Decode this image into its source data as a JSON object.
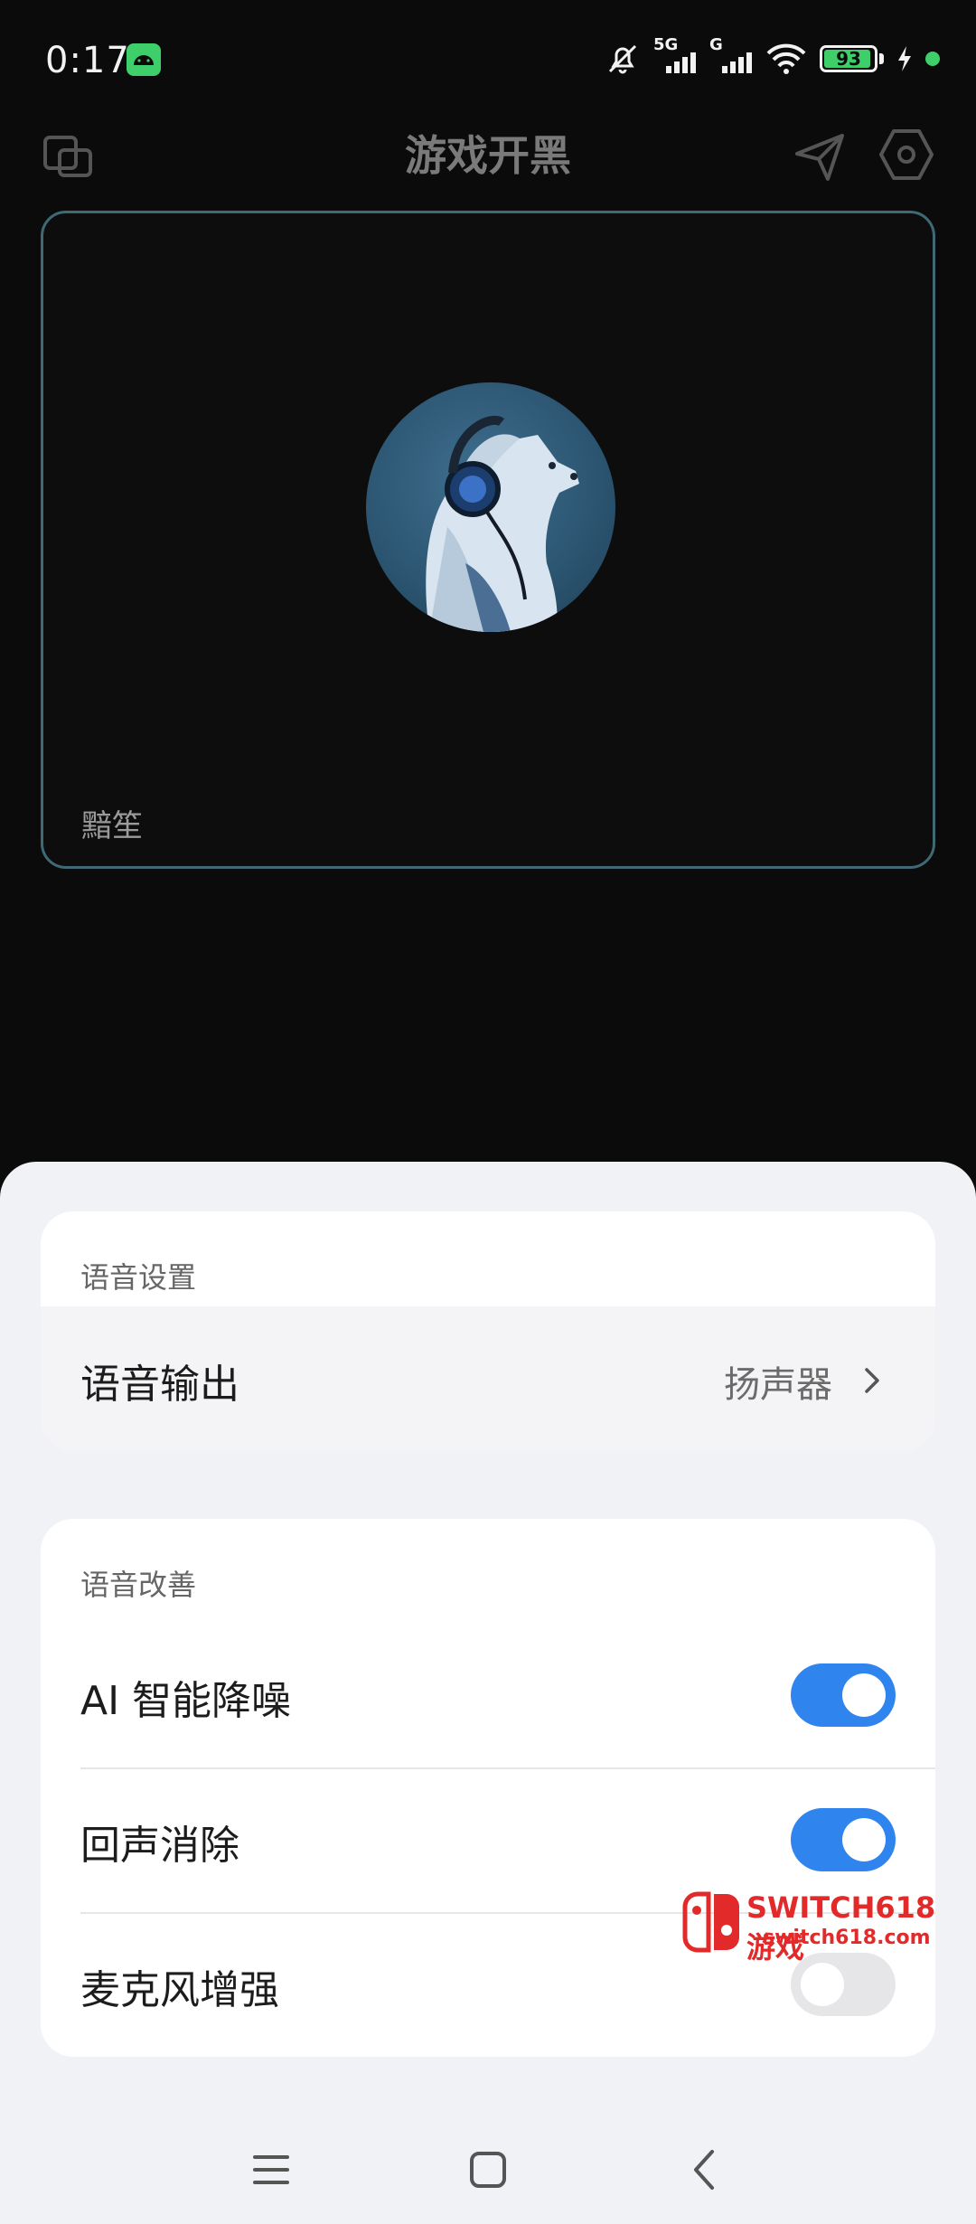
{
  "status_bar": {
    "time": "0:17",
    "network_1": "5G",
    "network_2": "G",
    "battery": "93"
  },
  "header": {
    "title": "游戏开黑"
  },
  "video_card": {
    "user_name": "黯笙"
  },
  "voice_settings": {
    "section_title": "语音设置",
    "output_label": "语音输出",
    "output_value": "扬声器"
  },
  "voice_improve": {
    "section_title": "语音改善",
    "items": [
      {
        "label": "AI 智能降噪",
        "enabled": true
      },
      {
        "label": "回声消除",
        "enabled": true
      },
      {
        "label": "麦克风增强",
        "enabled": false
      }
    ]
  },
  "watermark": {
    "title": "SWITCH618游戏",
    "url": "switch618.com"
  },
  "colors": {
    "accent": "#2f84ee",
    "card_border": "#3f6a75",
    "sheet_bg": "#f1f2f6",
    "watermark": "#e22a2a"
  },
  "icons": [
    "android-icon",
    "mute-bell-icon",
    "signal-icon",
    "wifi-icon",
    "battery-icon",
    "charging-icon",
    "window-switch-icon",
    "send-icon",
    "settings-hexagon-icon",
    "chevron-right-icon",
    "menu-icon",
    "home-icon",
    "back-icon"
  ]
}
